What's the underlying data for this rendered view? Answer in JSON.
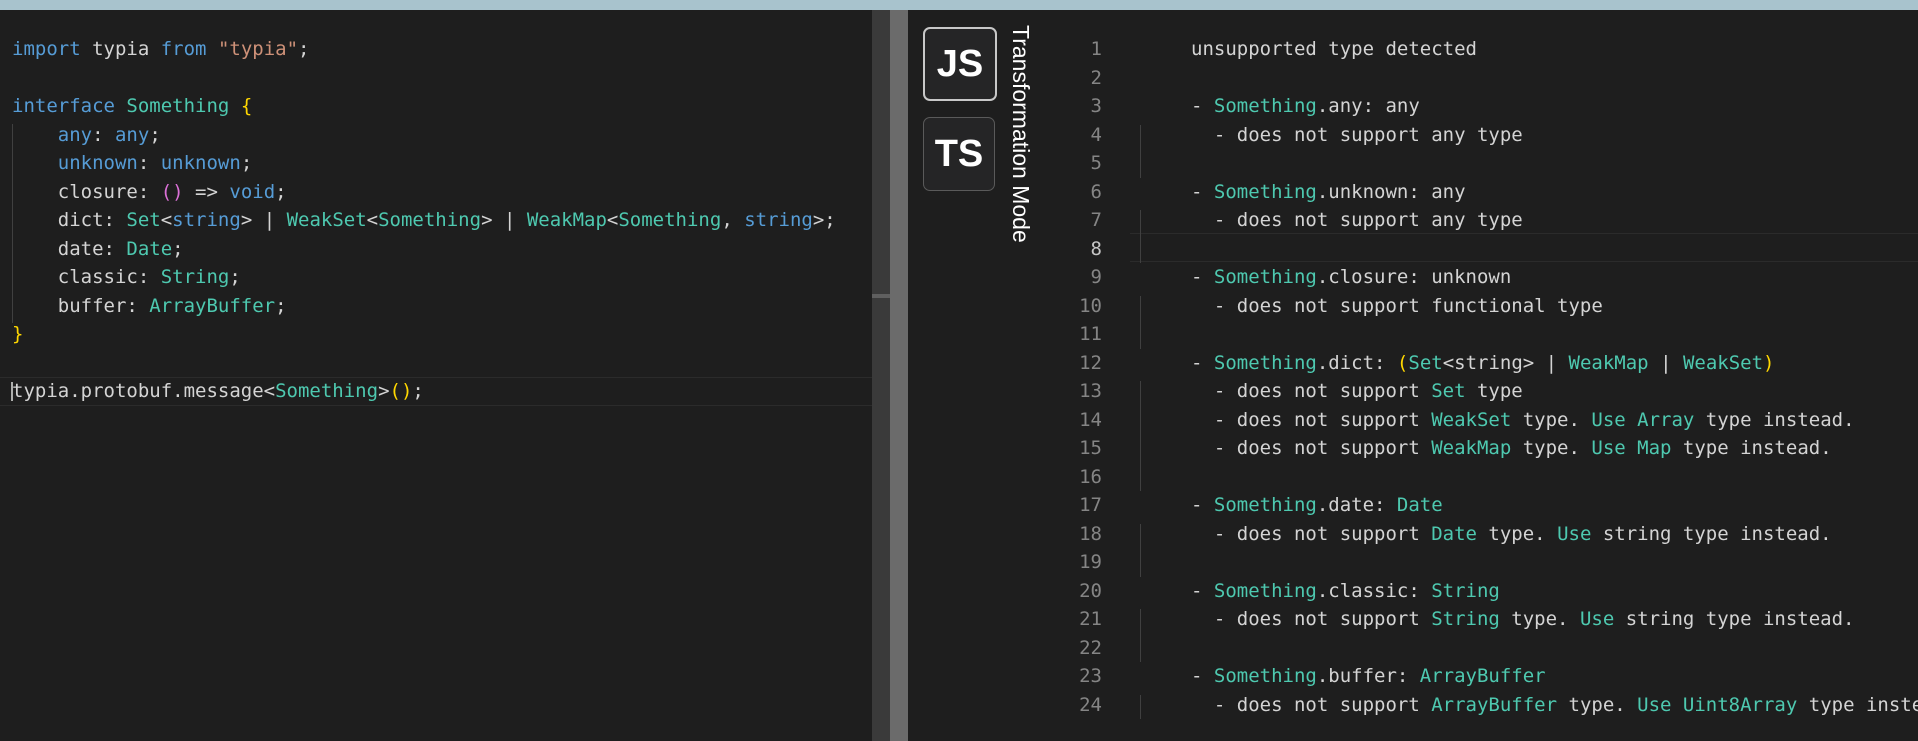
{
  "colors": {
    "keyword": "#569cd6",
    "type": "#4ec9b0",
    "string": "#ce9178",
    "brace": "#ffd700",
    "paren": "#da70d6",
    "text": "#d4d4d4",
    "background": "#1e1e1e"
  },
  "source_editor": {
    "lines": [
      [
        {
          "t": "import",
          "c": "kw"
        },
        {
          "t": " typia ",
          "c": "tx"
        },
        {
          "t": "from",
          "c": "kw"
        },
        {
          "t": " ",
          "c": "tx"
        },
        {
          "t": "\"typia\"",
          "c": "st"
        },
        {
          "t": ";",
          "c": "tx"
        }
      ],
      [],
      [
        {
          "t": "interface",
          "c": "kw"
        },
        {
          "t": " ",
          "c": "tx"
        },
        {
          "t": "Something",
          "c": "ty"
        },
        {
          "t": " ",
          "c": "tx"
        },
        {
          "t": "{",
          "c": "br"
        }
      ],
      [
        {
          "t": "    ",
          "c": "tx"
        },
        {
          "t": "any",
          "c": "kw"
        },
        {
          "t": ": ",
          "c": "tx"
        },
        {
          "t": "any",
          "c": "kw"
        },
        {
          "t": ";",
          "c": "tx"
        }
      ],
      [
        {
          "t": "    ",
          "c": "tx"
        },
        {
          "t": "unknown",
          "c": "kw"
        },
        {
          "t": ": ",
          "c": "tx"
        },
        {
          "t": "unknown",
          "c": "kw"
        },
        {
          "t": ";",
          "c": "tx"
        }
      ],
      [
        {
          "t": "    closure: ",
          "c": "tx"
        },
        {
          "t": "()",
          "c": "pu"
        },
        {
          "t": " => ",
          "c": "tx"
        },
        {
          "t": "void",
          "c": "kw"
        },
        {
          "t": ";",
          "c": "tx"
        }
      ],
      [
        {
          "t": "    dict: ",
          "c": "tx"
        },
        {
          "t": "Set",
          "c": "ty"
        },
        {
          "t": "<",
          "c": "tx"
        },
        {
          "t": "string",
          "c": "kw"
        },
        {
          "t": "> | ",
          "c": "tx"
        },
        {
          "t": "WeakSet",
          "c": "ty"
        },
        {
          "t": "<",
          "c": "tx"
        },
        {
          "t": "Something",
          "c": "ty"
        },
        {
          "t": "> | ",
          "c": "tx"
        },
        {
          "t": "WeakMap",
          "c": "ty"
        },
        {
          "t": "<",
          "c": "tx"
        },
        {
          "t": "Something",
          "c": "ty"
        },
        {
          "t": ", ",
          "c": "tx"
        },
        {
          "t": "string",
          "c": "kw"
        },
        {
          "t": ">;",
          "c": "tx"
        }
      ],
      [
        {
          "t": "    date: ",
          "c": "tx"
        },
        {
          "t": "Date",
          "c": "ty"
        },
        {
          "t": ";",
          "c": "tx"
        }
      ],
      [
        {
          "t": "    classic: ",
          "c": "tx"
        },
        {
          "t": "String",
          "c": "ty"
        },
        {
          "t": ";",
          "c": "tx"
        }
      ],
      [
        {
          "t": "    buffer: ",
          "c": "tx"
        },
        {
          "t": "ArrayBuffer",
          "c": "ty"
        },
        {
          "t": ";",
          "c": "tx"
        }
      ],
      [
        {
          "t": "}",
          "c": "br"
        }
      ],
      [],
      [
        {
          "t": "typia.protobuf.message<",
          "c": "tx"
        },
        {
          "t": "Something",
          "c": "ty"
        },
        {
          "t": ">",
          "c": "tx"
        },
        {
          "t": "()",
          "c": "br"
        },
        {
          "t": ";",
          "c": "tx"
        }
      ]
    ]
  },
  "mode_switch": {
    "js_label": "JS",
    "ts_label": "TS",
    "title": "Transformation Mode"
  },
  "output_editor": {
    "active_line": 8,
    "lines": [
      {
        "n": "1",
        "s": [
          {
            "t": "unsupported type detected",
            "c": "tx"
          }
        ]
      },
      {
        "n": "2",
        "s": []
      },
      {
        "n": "3",
        "s": [
          {
            "t": "- ",
            "c": "tx"
          },
          {
            "t": "Something",
            "c": "ty"
          },
          {
            "t": ".any: any",
            "c": "tx"
          }
        ]
      },
      {
        "n": "4",
        "s": [
          {
            "t": "  - does not support any type",
            "c": "tx"
          }
        ]
      },
      {
        "n": "5",
        "s": []
      },
      {
        "n": "6",
        "s": [
          {
            "t": "- ",
            "c": "tx"
          },
          {
            "t": "Something",
            "c": "ty"
          },
          {
            "t": ".unknown: any",
            "c": "tx"
          }
        ]
      },
      {
        "n": "7",
        "s": [
          {
            "t": "  - does not support any type",
            "c": "tx"
          }
        ]
      },
      {
        "n": "8",
        "s": []
      },
      {
        "n": "9",
        "s": [
          {
            "t": "- ",
            "c": "tx"
          },
          {
            "t": "Something",
            "c": "ty"
          },
          {
            "t": ".closure: unknown",
            "c": "tx"
          }
        ]
      },
      {
        "n": "10",
        "s": [
          {
            "t": "  - does not support functional type",
            "c": "tx"
          }
        ]
      },
      {
        "n": "11",
        "s": []
      },
      {
        "n": "12",
        "s": [
          {
            "t": "- ",
            "c": "tx"
          },
          {
            "t": "Something",
            "c": "ty"
          },
          {
            "t": ".dict: ",
            "c": "tx"
          },
          {
            "t": "(",
            "c": "br"
          },
          {
            "t": "Set",
            "c": "ty"
          },
          {
            "t": "<string> | ",
            "c": "tx"
          },
          {
            "t": "WeakMap",
            "c": "ty"
          },
          {
            "t": " | ",
            "c": "tx"
          },
          {
            "t": "WeakSet",
            "c": "ty"
          },
          {
            "t": ")",
            "c": "br"
          }
        ]
      },
      {
        "n": "13",
        "s": [
          {
            "t": "  - does not support ",
            "c": "tx"
          },
          {
            "t": "Set",
            "c": "ty"
          },
          {
            "t": " type",
            "c": "tx"
          }
        ]
      },
      {
        "n": "14",
        "s": [
          {
            "t": "  - does not support ",
            "c": "tx"
          },
          {
            "t": "WeakSet",
            "c": "ty"
          },
          {
            "t": " type. ",
            "c": "tx"
          },
          {
            "t": "Use",
            "c": "ty"
          },
          {
            "t": " ",
            "c": "tx"
          },
          {
            "t": "Array",
            "c": "ty"
          },
          {
            "t": " type instead.",
            "c": "tx"
          }
        ]
      },
      {
        "n": "15",
        "s": [
          {
            "t": "  - does not support ",
            "c": "tx"
          },
          {
            "t": "WeakMap",
            "c": "ty"
          },
          {
            "t": " type. ",
            "c": "tx"
          },
          {
            "t": "Use",
            "c": "ty"
          },
          {
            "t": " ",
            "c": "tx"
          },
          {
            "t": "Map",
            "c": "ty"
          },
          {
            "t": " type instead.",
            "c": "tx"
          }
        ]
      },
      {
        "n": "16",
        "s": []
      },
      {
        "n": "17",
        "s": [
          {
            "t": "- ",
            "c": "tx"
          },
          {
            "t": "Something",
            "c": "ty"
          },
          {
            "t": ".date: ",
            "c": "tx"
          },
          {
            "t": "Date",
            "c": "ty"
          }
        ]
      },
      {
        "n": "18",
        "s": [
          {
            "t": "  - does not support ",
            "c": "tx"
          },
          {
            "t": "Date",
            "c": "ty"
          },
          {
            "t": " type. ",
            "c": "tx"
          },
          {
            "t": "Use",
            "c": "ty"
          },
          {
            "t": " string type instead.",
            "c": "tx"
          }
        ]
      },
      {
        "n": "19",
        "s": []
      },
      {
        "n": "20",
        "s": [
          {
            "t": "- ",
            "c": "tx"
          },
          {
            "t": "Something",
            "c": "ty"
          },
          {
            "t": ".classic: ",
            "c": "tx"
          },
          {
            "t": "String",
            "c": "ty"
          }
        ]
      },
      {
        "n": "21",
        "s": [
          {
            "t": "  - does not support ",
            "c": "tx"
          },
          {
            "t": "String",
            "c": "ty"
          },
          {
            "t": " type. ",
            "c": "tx"
          },
          {
            "t": "Use",
            "c": "ty"
          },
          {
            "t": " string type instead.",
            "c": "tx"
          }
        ]
      },
      {
        "n": "22",
        "s": []
      },
      {
        "n": "23",
        "s": [
          {
            "t": "- ",
            "c": "tx"
          },
          {
            "t": "Something",
            "c": "ty"
          },
          {
            "t": ".buffer: ",
            "c": "tx"
          },
          {
            "t": "ArrayBuffer",
            "c": "ty"
          }
        ]
      },
      {
        "n": "24",
        "s": [
          {
            "t": "  - does not support ",
            "c": "tx"
          },
          {
            "t": "ArrayBuffer",
            "c": "ty"
          },
          {
            "t": " type. ",
            "c": "tx"
          },
          {
            "t": "Use",
            "c": "ty"
          },
          {
            "t": " ",
            "c": "tx"
          },
          {
            "t": "Uint8Array",
            "c": "ty"
          },
          {
            "t": " type instead.",
            "c": "tx"
          }
        ]
      }
    ]
  }
}
